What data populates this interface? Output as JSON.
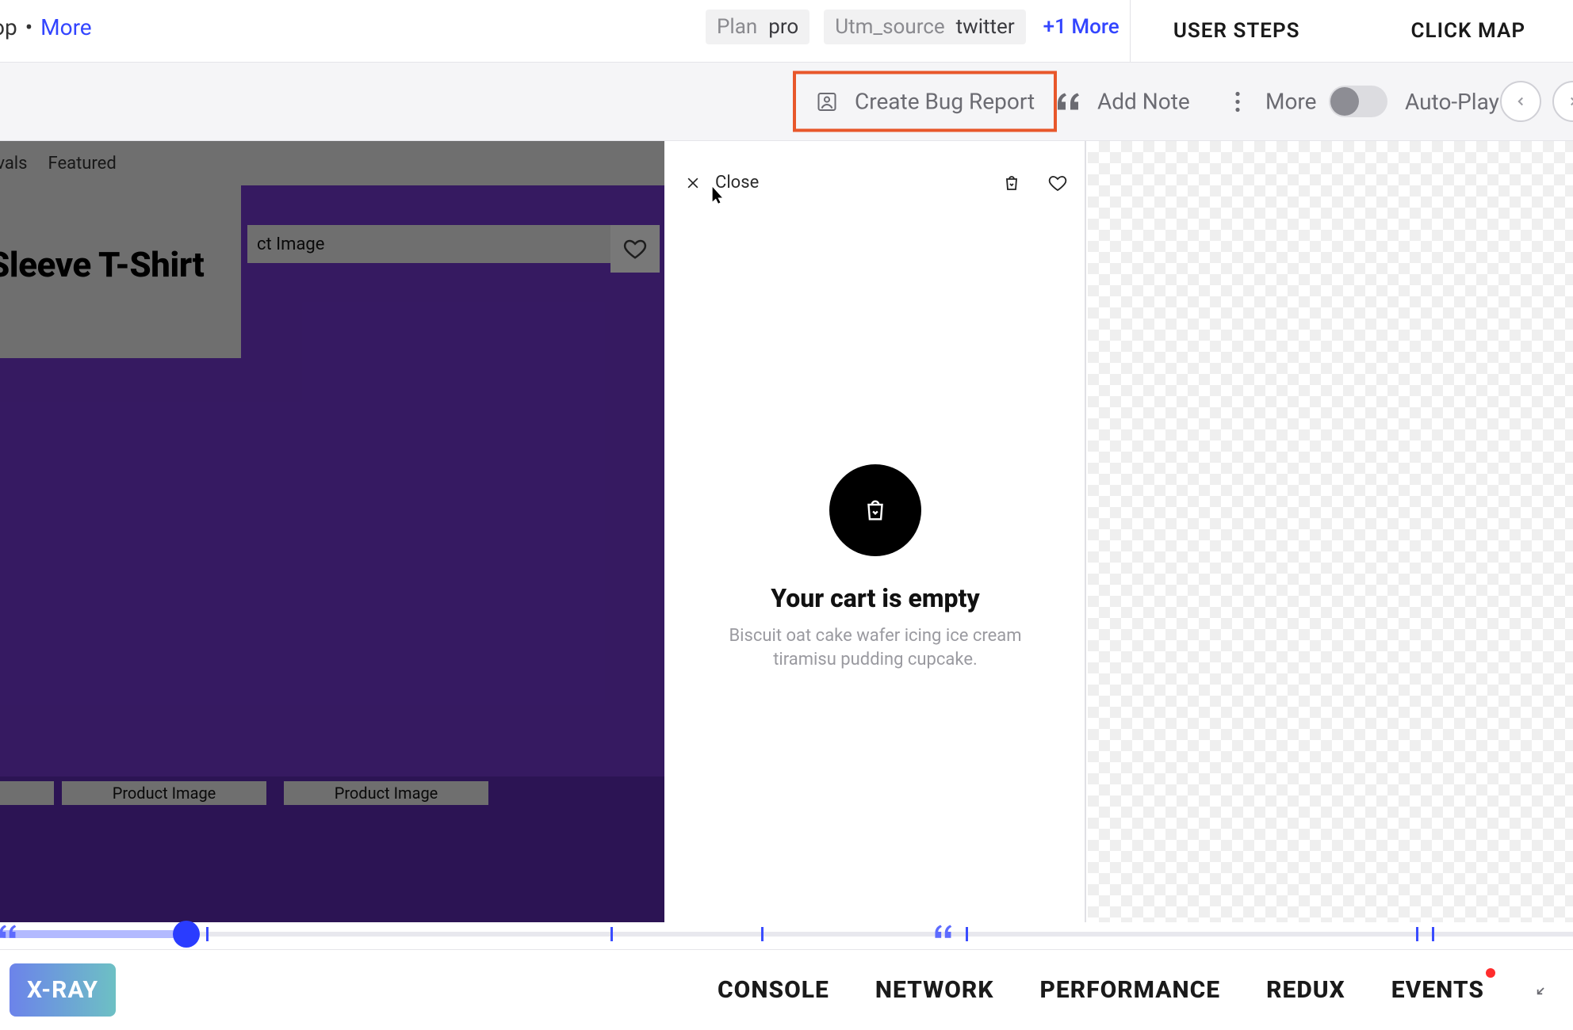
{
  "breadcrumb": {
    "op": "op",
    "sep": "•",
    "more": "More"
  },
  "tags": [
    {
      "key": "Plan",
      "value": "pro"
    },
    {
      "key": "Utm_source",
      "value": "twitter"
    }
  ],
  "more_tags": "+1 More",
  "right_tabs": {
    "user_steps": "USER STEPS",
    "click_map": "CLICK MAP"
  },
  "toolbar": {
    "bug_report": "Create Bug Report",
    "add_note": "Add Note",
    "more": "More",
    "autoplay": "Auto-Play"
  },
  "replay_page": {
    "nav1": "ivals",
    "nav2": "Featured",
    "hero_title": "t Sleeve T-Shirt",
    "prod_label": "ct Image",
    "thumb_label": "Product Image"
  },
  "cart_panel": {
    "close": "Close",
    "title": "Your cart is empty",
    "desc": "Biscuit oat cake wafer icing ice cream tiramisu pudding cupcake."
  },
  "dock": {
    "xray": "X-RAY",
    "tabs": {
      "console": "CONSOLE",
      "network": "NETWORK",
      "performance": "PERFORMANCE",
      "redux": "REDUX",
      "events": "EVENTS"
    }
  }
}
